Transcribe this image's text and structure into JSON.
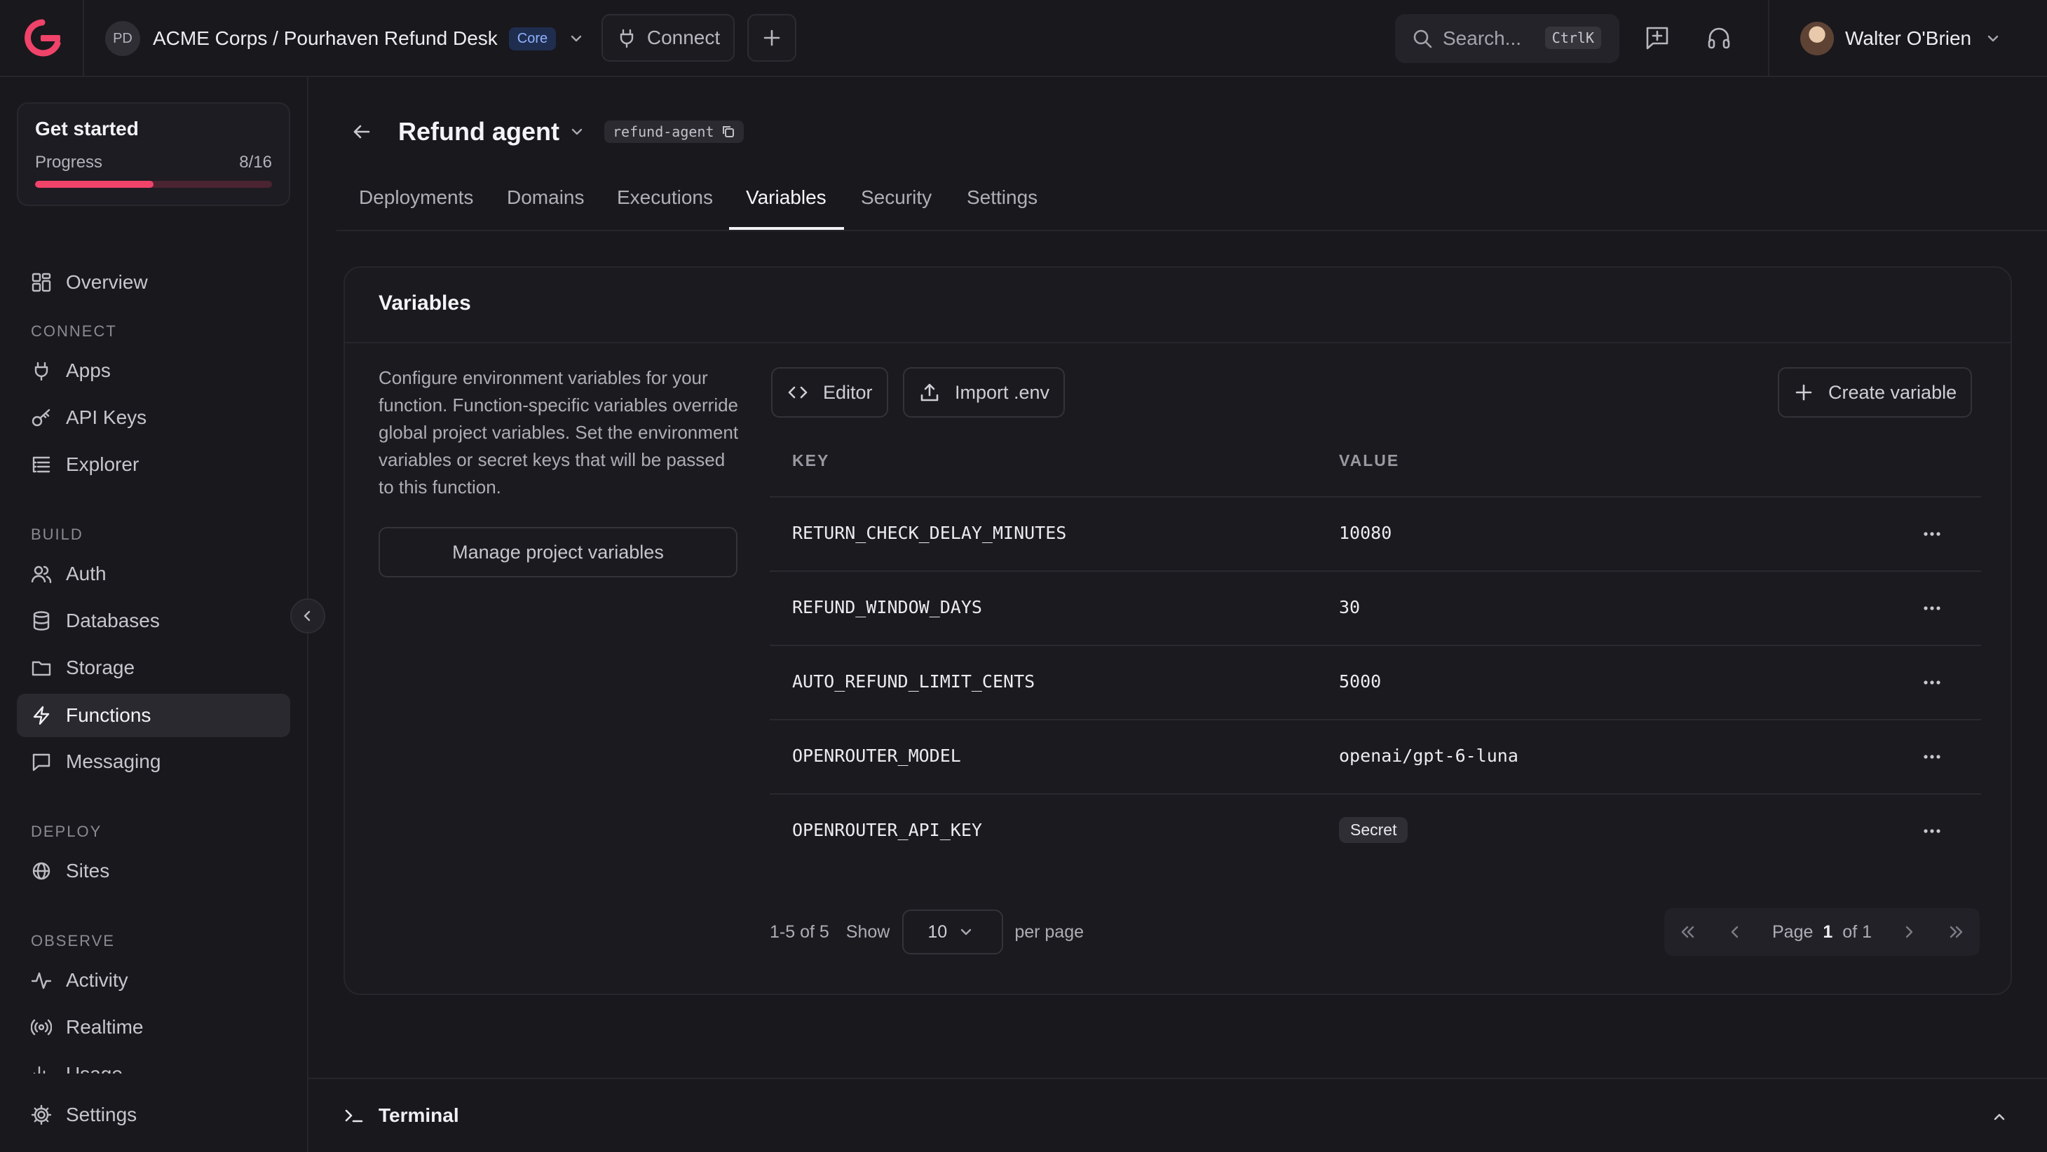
{
  "topbar": {
    "project_initials": "PD",
    "project_name": "ACME Corps / Pourhaven Refund Desk",
    "plan_badge": "Core",
    "connect_label": "Connect",
    "search_placeholder": "Search...",
    "search_shortcut": "CtrlK",
    "user_name": "Walter O'Brien"
  },
  "sidebar": {
    "get_started": {
      "title": "Get started",
      "progress_label": "Progress",
      "progress_text": "8/16",
      "progress_fraction": 0.5
    },
    "overview": "Overview",
    "sections": {
      "connect": "CONNECT",
      "build": "BUILD",
      "deploy": "DEPLOY",
      "observe": "OBSERVE"
    },
    "items": {
      "apps": "Apps",
      "api_keys": "API Keys",
      "explorer": "Explorer",
      "auth": "Auth",
      "databases": "Databases",
      "storage": "Storage",
      "functions": "Functions",
      "messaging": "Messaging",
      "sites": "Sites",
      "activity": "Activity",
      "realtime": "Realtime",
      "usage": "Usage",
      "settings": "Settings"
    }
  },
  "page": {
    "title": "Refund agent",
    "slug": "refund-agent",
    "tabs": [
      "Deployments",
      "Domains",
      "Executions",
      "Variables",
      "Security",
      "Settings"
    ],
    "active_tab": "Variables"
  },
  "variables": {
    "title": "Variables",
    "description": "Configure environment variables for your function. Function-specific variables override global project variables. Set the environment variables or secret keys that will be passed to this function.",
    "manage_button": "Manage project variables",
    "editor_button": "Editor",
    "import_button": "Import .env",
    "create_button": "Create variable",
    "columns": {
      "key": "KEY",
      "value": "VALUE"
    },
    "rows": [
      {
        "key": "RETURN_CHECK_DELAY_MINUTES",
        "value": "10080"
      },
      {
        "key": "REFUND_WINDOW_DAYS",
        "value": "30"
      },
      {
        "key": "AUTO_REFUND_LIMIT_CENTS",
        "value": "5000"
      },
      {
        "key": "OPENROUTER_MODEL",
        "value": "openai/gpt-6-luna"
      },
      {
        "key": "OPENROUTER_API_KEY",
        "secret_label": "Secret"
      }
    ],
    "pagination": {
      "range": "1-5 of 5",
      "show_label": "Show",
      "per_page_value": "10",
      "per_page_label": "per page",
      "page_label": "Page",
      "page_current": "1",
      "page_total": "of 1"
    }
  },
  "terminal": {
    "label": "Terminal"
  },
  "colors": {
    "accent": "#f0436a",
    "background": "#19181d",
    "card": "#1b1a1f",
    "badge_blue": "#8fb2ff"
  }
}
